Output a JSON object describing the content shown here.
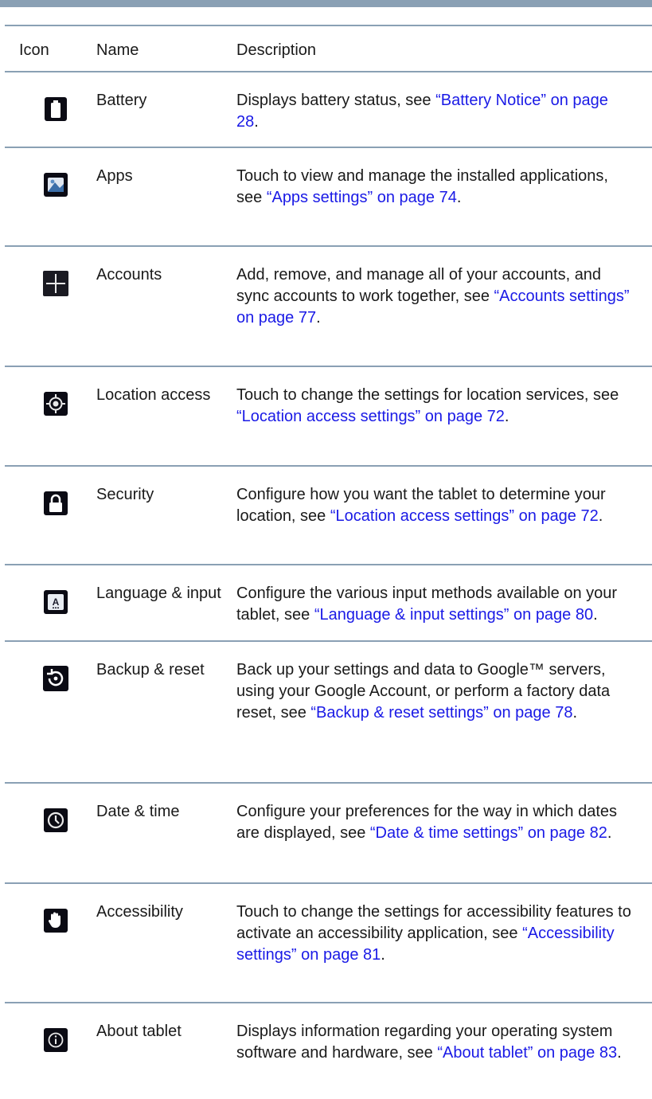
{
  "table": {
    "headers": {
      "icon": "Icon",
      "name": "Name",
      "description": "Description"
    },
    "rows": [
      {
        "icon": "battery-icon",
        "name": "Battery",
        "desc_text": "Displays battery status, see ",
        "desc_link": "“Battery Notice” on page 28",
        "desc_end": "."
      },
      {
        "icon": "apps-icon",
        "name": "Apps",
        "desc_text": "Touch to view and manage the installed applications, see ",
        "desc_link": "“Apps settings” on page 74",
        "desc_end": "."
      },
      {
        "icon": "plus-icon",
        "name": "Accounts",
        "desc_text": "Add, remove, and manage all of your accounts, and sync accounts to work together, see ",
        "desc_link": "“Accounts settings” on page 77",
        "desc_end": "."
      },
      {
        "icon": "location-icon",
        "name": "Location access",
        "desc_text": "Touch to change the settings for location services, see ",
        "desc_link": "“Location access settings” on page 72",
        "desc_end": "."
      },
      {
        "icon": "lock-icon",
        "name": "Security",
        "desc_text": "Configure how you want the tablet to determine your location, see ",
        "desc_link": "“Location access settings” on page 72",
        "desc_end": "."
      },
      {
        "icon": "language-icon",
        "name": "Language & input",
        "desc_text": "Configure the various input methods available on your tablet, see ",
        "desc_link": "“Language & input settings” on page 80",
        "desc_end": "."
      },
      {
        "icon": "backup-icon",
        "name": "Backup & reset",
        "desc_text": "Back up your settings and data to Google™ servers, using your Google Account, or perform a factory data reset, see ",
        "desc_link": "“Backup & reset settings” on page 78",
        "desc_end": "."
      },
      {
        "icon": "clock-icon",
        "name": "Date & time",
        "desc_text": "Configure your preferences for the way in which dates are displayed, see ",
        "desc_link": "“Date & time settings” on page 82",
        "desc_end": "."
      },
      {
        "icon": "hand-icon",
        "name": "Accessibility",
        "desc_text": "Touch to change the settings for accessibility features to activate an accessibility application, see ",
        "desc_link": "“Accessibility settings” on page 81",
        "desc_end": "."
      },
      {
        "icon": "info-icon",
        "name": "About tablet",
        "desc_text": "Displays information regarding your operating system software and hardware, see ",
        "desc_link": "“About tablet” on page 83",
        "desc_end": "."
      }
    ]
  }
}
